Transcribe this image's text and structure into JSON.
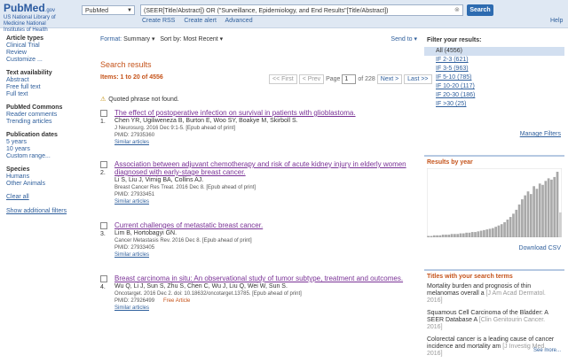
{
  "header": {
    "logo_text": "PubMed",
    "logo_suffix": ".gov",
    "nlm_text": "US National Library of Medicine National Institutes of Health",
    "database": "PubMed",
    "query": "(SEER[Title/Abstract]) OR (\"Surveillance, Epidemiology, and End Results\"[Title/Abstract])",
    "search_label": "Search",
    "create_rss": "Create RSS",
    "create_alert": "Create alert",
    "advanced": "Advanced",
    "help": "Help"
  },
  "sidebar": {
    "groups": [
      {
        "heading": "Article types",
        "items": [
          "Clinical Trial",
          "Review",
          "Customize ..."
        ]
      },
      {
        "heading": "Text availability",
        "items": [
          "Abstract",
          "Free full text",
          "Full text"
        ]
      },
      {
        "heading": "PubMed Commons",
        "items": [
          "Reader comments",
          "Trending articles"
        ]
      },
      {
        "heading": "Publication dates",
        "items": [
          "5 years",
          "10 years",
          "Custom range..."
        ]
      },
      {
        "heading": "Species",
        "items": [
          "Humans",
          "Other Animals"
        ]
      }
    ],
    "clear_all": "Clear all",
    "show_filters": "Show additional filters"
  },
  "main": {
    "format_label": "Format:",
    "format_value": "Summary ▾",
    "sort_label": "Sort by:",
    "sort_value": "Most Recent ▾",
    "send_to": "Send to ▾",
    "results_title": "Search results",
    "items_count": "Items: 1 to 20 of 4556",
    "pager": {
      "first": "<< First",
      "prev": "< Prev",
      "page_label": "Page",
      "page_value": "1",
      "of_text": "of 228",
      "next": "Next >",
      "last": "Last >>"
    },
    "warning": "Quoted phrase not found.",
    "results": [
      {
        "num": "1.",
        "title": "The effect of postoperative infection on survival in patients with glioblastoma.",
        "authors": "Chen YR, Ugiliweneza B, Burton E, Woo SY, Boakye M, Skirboll S.",
        "journal": "J Neurosurg. 2016 Dec 9:1-5. [Epub ahead of print]",
        "pmid": "PMID: 27935360",
        "similar": "Similar articles",
        "free": ""
      },
      {
        "num": "2.",
        "title": "Association between adjuvant chemotherapy and risk of acute kidney injury in elderly women diagnosed with early-stage breast cancer.",
        "authors": "Li S, Liu J, Virnig BA, Collins AJ.",
        "journal": "Breast Cancer Res Treat. 2016 Dec 8. [Epub ahead of print]",
        "pmid": "PMID: 27933451",
        "similar": "Similar articles",
        "free": ""
      },
      {
        "num": "3.",
        "title": "Current challenges of metastatic breast cancer.",
        "authors": "Lim B, Hortobagyi GN.",
        "journal": "Cancer Metastasis Rev. 2016 Dec 8. [Epub ahead of print]",
        "pmid": "PMID: 27933405",
        "similar": "Similar articles",
        "free": ""
      },
      {
        "num": "4.",
        "title": "Breast carcinoma in situ: An observational study of tumor subtype, treatment and outcomes.",
        "authors": "Wu Q, Li J, Sun S, Zhu S, Chen C, Wu J, Liu Q, Wei W, Sun S.",
        "journal": "Oncotarget. 2016 Dec 2. doi: 10.18632/oncotarget.13785. [Epub ahead of print]",
        "pmid": "PMID: 27926499",
        "similar": "Similar articles",
        "free": "Free Article"
      }
    ]
  },
  "rightbar": {
    "filter_heading": "Filter your results:",
    "filters": [
      "All (4556)",
      "IF 2-3 (621)",
      "IF 3-5 (963)",
      "IF 5-10 (785)",
      "IF 10-20 (117)",
      "IF 20-30 (186)",
      "IF >30 (25)"
    ],
    "manage_filters": "Manage Filters",
    "results_by_year": "Results by year",
    "download_csv": "Download CSV",
    "terms_heading": "Titles with your search terms",
    "terms": [
      {
        "text": "Mortality burden and prognosis of thin melanomas overall a",
        "src": "[J Am Acad Dermatol. 2016]"
      },
      {
        "text": "Squamous Cell Carcinoma of the Bladder: A SEER Database A",
        "src": "[Clin Genitourin Cancer. 2016]"
      },
      {
        "text": "Colorectal cancer is a leading cause of cancer incidence and mortality am",
        "src": "[J Investig Med. 2016]"
      }
    ],
    "see_more": "See more..."
  },
  "chart_data": {
    "type": "bar",
    "title": "Results by year",
    "values": [
      2,
      2,
      3,
      3,
      3,
      4,
      4,
      4,
      5,
      5,
      5,
      6,
      6,
      7,
      7,
      8,
      8,
      9,
      10,
      11,
      12,
      13,
      14,
      16,
      18,
      20,
      23,
      27,
      31,
      36,
      42,
      50,
      58,
      64,
      70,
      66,
      78,
      74,
      82,
      80,
      86,
      90,
      88,
      92,
      100,
      38
    ],
    "ylim": [
      0,
      100
    ]
  },
  "colors": {
    "accent": "#2d6bb0",
    "heading_orange": "#c5531a",
    "header_bg": "#dfe8f3",
    "active_filter_bg": "#d2dff0"
  }
}
